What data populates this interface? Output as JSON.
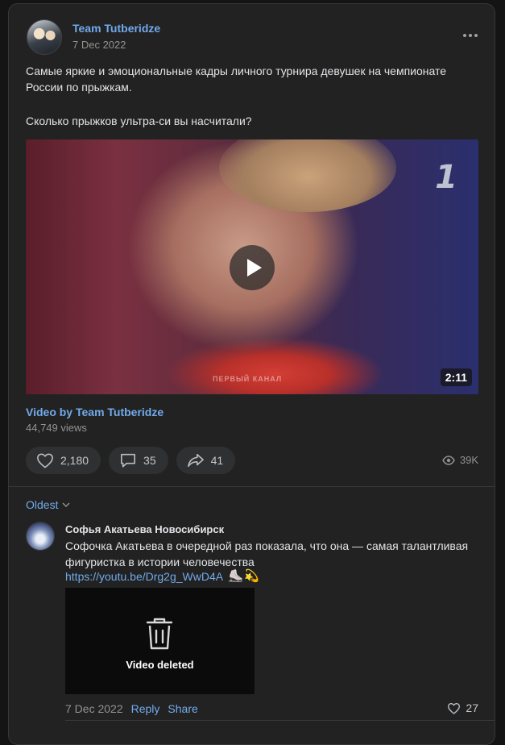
{
  "post": {
    "author": "Team Tutberidze",
    "date": "7 Dec 2022",
    "text_line1": "Самые яркие и эмоциональные кадры личного турнира девушек на чемпионате России по прыжкам.",
    "text_line2": "Сколько прыжков ультра-си вы насчитали?",
    "video": {
      "duration": "2:11",
      "channel_logo": "1",
      "watermark": "ПЕРВЫЙ КАНАЛ",
      "caption": "Video by Team Tutberidze",
      "views": "44,749 views"
    },
    "likes": "2,180",
    "comments": "35",
    "shares": "41",
    "total_views": "39K"
  },
  "comments_section": {
    "sort_label": "Oldest",
    "comment": {
      "author": "Софья Акатьева Новосибирск",
      "text": "Софочка Акатьева в очередной раз показала, что она — самая талантливая фигуристка в истории человечества",
      "link": "https://youtu.be/Drg2g_WwD4A",
      "emoji1": "⛸️",
      "emoji2": "💫",
      "deleted_label": "Video deleted",
      "date": "7 Dec 2022",
      "reply_label": "Reply",
      "share_label": "Share",
      "likes": "27"
    }
  },
  "colors": {
    "accent": "#71aaeb",
    "background": "#141414",
    "card": "#222222",
    "muted": "#939393"
  },
  "icons": [
    "more-icon",
    "play-icon",
    "heart-icon",
    "comment-icon",
    "share-icon",
    "eye-icon",
    "chevron-down-icon",
    "trash-icon"
  ]
}
